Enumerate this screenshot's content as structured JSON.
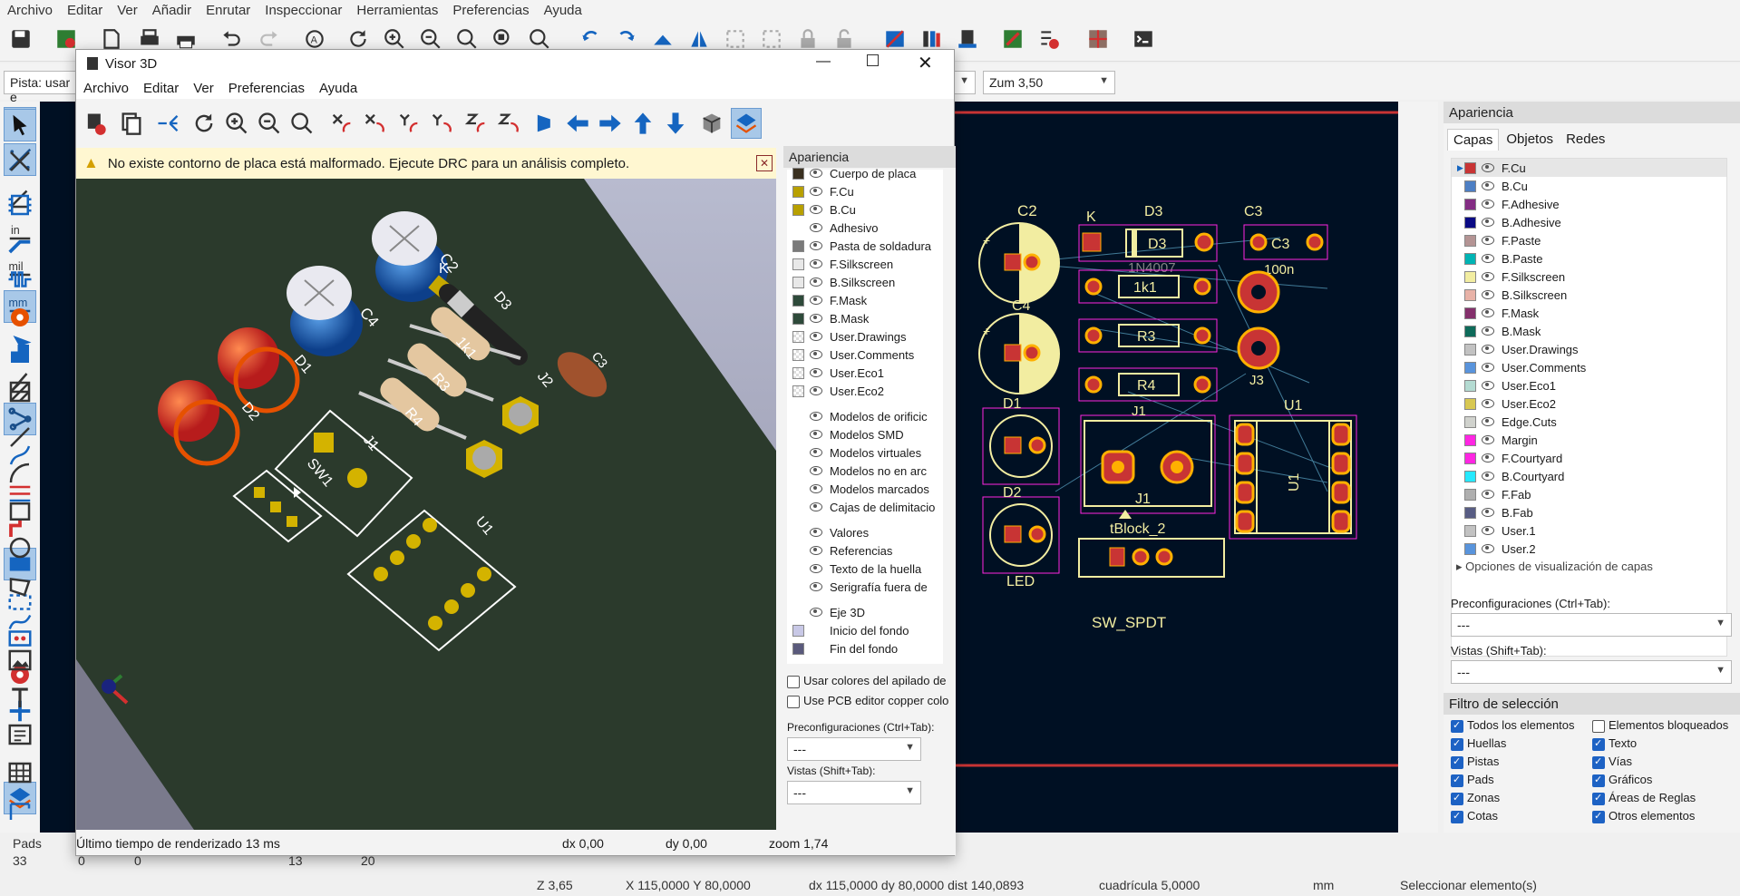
{
  "main_menu": [
    "Archivo",
    "Editar",
    "Ver",
    "Añadir",
    "Enrutar",
    "Inspeccionar",
    "Herramientas",
    "Preferencias",
    "Ayuda"
  ],
  "options": {
    "track_combo": "Pista: usar e",
    "zoom_combo": "Zum 3,50"
  },
  "viewer": {
    "title": "Visor 3D",
    "menu": [
      "Archivo",
      "Editar",
      "Ver",
      "Preferencias",
      "Ayuda"
    ],
    "warning": "No existe contorno de placa está malformado. Ejecute DRC para un análisis completo.",
    "panel_title": "Apariencia",
    "layers": [
      {
        "label": "Cuerpo de placa",
        "color": "#3a3020"
      },
      {
        "label": "F.Cu",
        "color": "#b8a000"
      },
      {
        "label": "B.Cu",
        "color": "#b8a000"
      },
      {
        "label": "Adhesivo",
        "color": ""
      },
      {
        "label": "Pasta de soldadura",
        "color": "#7a7a7a"
      },
      {
        "label": "F.Silkscreen",
        "color": "#e8e8e8"
      },
      {
        "label": "B.Silkscreen",
        "color": "#e8e8e8"
      },
      {
        "label": "F.Mask",
        "color": "#2e4a3a"
      },
      {
        "label": "B.Mask",
        "color": "#2e4a3a"
      },
      {
        "label": "User.Drawings",
        "color": "checker"
      },
      {
        "label": "User.Comments",
        "color": "checker"
      },
      {
        "label": "User.Eco1",
        "color": "checker"
      },
      {
        "label": "User.Eco2",
        "color": "checker"
      }
    ],
    "models": [
      "Modelos de orificic",
      "Modelos SMD",
      "Modelos virtuales",
      "Modelos no en arc",
      "Modelos marcados",
      "Cajas de delimitacio"
    ],
    "texts": [
      "Valores",
      "Referencias",
      "Texto de la huella",
      "Serigrafía fuera de"
    ],
    "misc": [
      "Eje 3D",
      "Inicio del fondo",
      "Fin del fondo"
    ],
    "check1": "Usar colores del apilado de",
    "check2": "Use PCB editor copper colo",
    "presets_label": "Preconfiguraciones (Ctrl+Tab):",
    "presets_value": "---",
    "views_label": "Vistas (Shift+Tab):",
    "views_value": "---",
    "status": {
      "render": "Último tiempo de renderizado 13 ms",
      "dx": "dx 0,00",
      "dy": "dy 0,00",
      "zoom": "zoom 1,74"
    },
    "labels3d": {
      "c2": "C2",
      "c4": "C4",
      "k": "K",
      "d3": "D3",
      "r1": "1k1",
      "r3": "R3",
      "r4": "R4",
      "d1": "D1",
      "d2": "D2",
      "j1": "J1",
      "j2": "J2",
      "c3": "C3",
      "sw1": "SW1",
      "u1": "U1"
    }
  },
  "pcb": {
    "c2": "C2",
    "k": "K",
    "d3": "D3",
    "c3": "C3",
    "d3pad": "D3",
    "n4007": "1N4007",
    "r1": "1k1",
    "r3": "R3",
    "r4": "R4",
    "n100": "100n",
    "c4": "C4",
    "d1": "D1",
    "d2": "D2",
    "j3": "J3",
    "u1": "U1",
    "u1v": "U1",
    "j1": "J1",
    "j1b": "J1",
    "tblock": "tBlock_2",
    "led": "LED",
    "sw": "SW_SPDT"
  },
  "appearance": {
    "title": "Apariencia",
    "tabs": [
      "Capas",
      "Objetos",
      "Redes"
    ],
    "layers": [
      {
        "label": "F.Cu",
        "color": "#c83434"
      },
      {
        "label": "B.Cu",
        "color": "#4d7fc4"
      },
      {
        "label": "F.Adhesive",
        "color": "#842d84"
      },
      {
        "label": "B.Adhesive",
        "color": "#0a0a84"
      },
      {
        "label": "F.Paste",
        "color": "#b49494"
      },
      {
        "label": "B.Paste",
        "color": "#00b4b4"
      },
      {
        "label": "F.Silkscreen",
        "color": "#f2eda1"
      },
      {
        "label": "B.Silkscreen",
        "color": "#e8b2a7"
      },
      {
        "label": "F.Mask",
        "color": "#84306c"
      },
      {
        "label": "B.Mask",
        "color": "#0e6b5a"
      },
      {
        "label": "User.Drawings",
        "color": "#c2c2c2"
      },
      {
        "label": "User.Comments",
        "color": "#5994dc"
      },
      {
        "label": "User.Eco1",
        "color": "#b4dbd2"
      },
      {
        "label": "User.Eco2",
        "color": "#d8c852"
      },
      {
        "label": "Edge.Cuts",
        "color": "#d0d2cd"
      },
      {
        "label": "Margin",
        "color": "#ff26e2"
      },
      {
        "label": "F.Courtyard",
        "color": "#ff26e2"
      },
      {
        "label": "B.Courtyard",
        "color": "#26e9ff"
      },
      {
        "label": "F.Fab",
        "color": "#afafaf"
      },
      {
        "label": "B.Fab",
        "color": "#585d84"
      },
      {
        "label": "User.1",
        "color": "#c2c2c2"
      },
      {
        "label": "User.2",
        "color": "#5994dc"
      }
    ],
    "layer_options": "Opciones de visualización de capas",
    "presets_label": "Preconfiguraciones (Ctrl+Tab):",
    "presets_value": "---",
    "views_label": "Vistas (Shift+Tab):",
    "views_value": "---",
    "filter_title": "Filtro de selección",
    "filters": [
      {
        "label": "Todos los elementos",
        "on": true
      },
      {
        "label": "Elementos bloqueados",
        "on": false
      },
      {
        "label": "Huellas",
        "on": true
      },
      {
        "label": "Texto",
        "on": true
      },
      {
        "label": "Pistas",
        "on": true
      },
      {
        "label": "Vías",
        "on": true
      },
      {
        "label": "Pads",
        "on": true
      },
      {
        "label": "Gráficos",
        "on": true
      },
      {
        "label": "Zonas",
        "on": true
      },
      {
        "label": "Áreas de Reglas",
        "on": true
      },
      {
        "label": "Cotas",
        "on": true
      },
      {
        "label": "Otros elementos",
        "on": true
      }
    ]
  },
  "status": {
    "pads_label": "Pads",
    "pads_value": "33",
    "v0": "0",
    "v1": "0",
    "v2": "13",
    "v3": "20",
    "z": "Z 3,65",
    "xy": "X 115,0000  Y 80,0000",
    "dxy": "dx 115,0000  dy 80,0000  dist 140,0893",
    "grid": "cuadrícula 5,0000",
    "unit": "mm",
    "action": "Seleccionar elemento(s)"
  }
}
